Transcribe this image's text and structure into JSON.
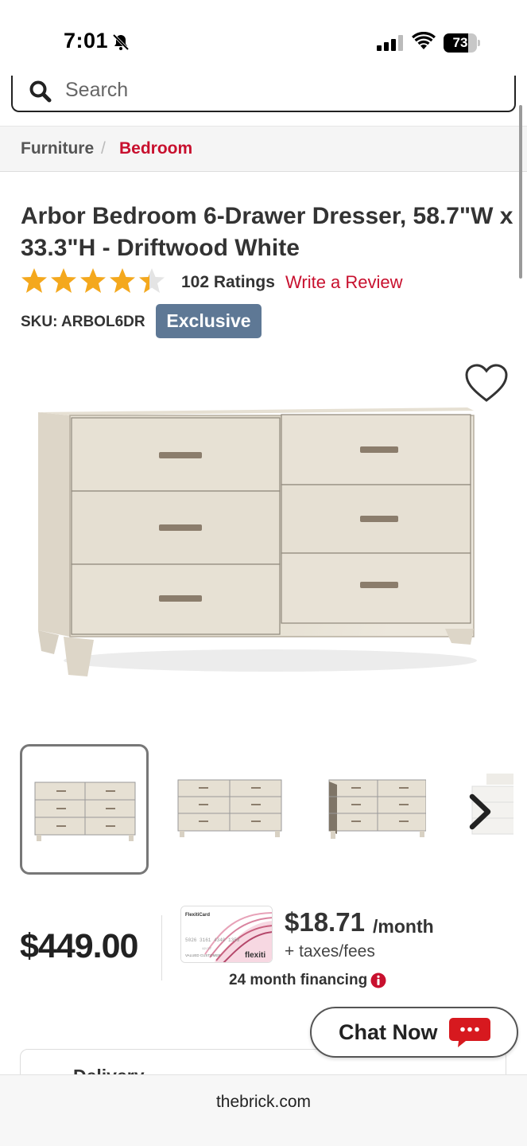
{
  "status_bar": {
    "time": "7:01",
    "battery": "73",
    "battery_level": 0.73,
    "icons": [
      "bell-slash-icon",
      "signal-icon",
      "wifi-icon",
      "battery-icon"
    ]
  },
  "search": {
    "placeholder": "Search"
  },
  "breadcrumb": {
    "items": [
      "Furniture",
      "Bedroom"
    ],
    "separator": "/"
  },
  "product": {
    "title": "Arbor Bedroom 6-Drawer Dresser, 58.7\"W x 33.3\"H - Driftwood White",
    "rating_value": 4.5,
    "rating_max": 5,
    "ratings_count": "102 Ratings",
    "write_review": "Write a Review",
    "sku": "SKU: ARBOL6DR",
    "badge": "Exclusive"
  },
  "pricing": {
    "price": "$449.00",
    "monthly_amount": "$18.71",
    "monthly_unit": "/month",
    "taxes": "+ taxes/fees",
    "financing": "24 month financing",
    "card_brand": "flexiti",
    "card_name": "FlexitiCard",
    "card_number": "5026 3161 4340 1359",
    "card_holder": "VALUED CUSTOMER",
    "card_expiry": "12/27"
  },
  "delivery": {
    "title": "Delivery"
  },
  "chat": {
    "label": "Chat Now"
  },
  "browser": {
    "url": "thebrick.com"
  },
  "colors": {
    "brand_red": "#c8102e",
    "badge_blue": "#5e7895",
    "star": "#f4a81d"
  }
}
